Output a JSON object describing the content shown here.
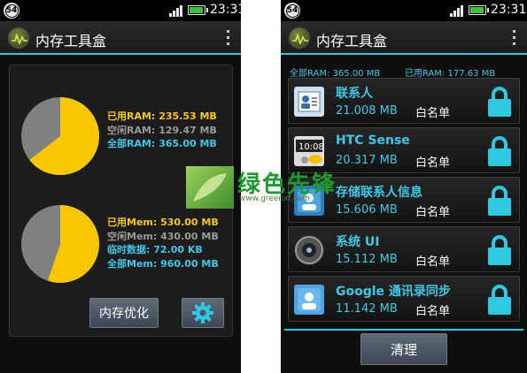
{
  "left_screen": {
    "status_bar": {
      "notification_count": "54",
      "time": "23:31"
    },
    "app_title": "内存工具盒",
    "ram_stats": {
      "used_label": "已用RAM:",
      "used_value": "235.53 MB",
      "free_label": "空闲RAM:",
      "free_value": "129.47 MB",
      "total_label": "全部RAM:",
      "total_value": "365.00 MB",
      "used_fraction": 0.645
    },
    "mem_stats": {
      "used_label": "已用Mem:",
      "used_value": "530.00 MB",
      "free_label": "空闲Mem:",
      "free_value": "430.00 MB",
      "temp_label": "临时数据:",
      "temp_value": "72.00 KB",
      "total_label": "全部Mem:",
      "total_value": "960.00 MB",
      "used_fraction": 0.552
    },
    "optimize_button": "内存优化"
  },
  "right_screen": {
    "status_bar": {
      "notification_count": "54",
      "time": "23:31"
    },
    "app_title": "内存工具盒",
    "summary": {
      "total": "全部RAM: 365.00 MB",
      "used": "已用RAM: 177.63 MB"
    },
    "apps": [
      {
        "name": "联系人",
        "size": "21.008 MB",
        "tag": "白名单",
        "icon": "contacts-icon"
      },
      {
        "name": "HTC Sense",
        "size": "20.317 MB",
        "tag": "白名单",
        "icon": "htc-sense-icon"
      },
      {
        "name": "存储联系人信息",
        "size": "15.606 MB",
        "tag": "白名单",
        "icon": "contacts-storage-icon"
      },
      {
        "name": "系统 UI",
        "size": "15.112 MB",
        "tag": "白名单",
        "icon": "system-ui-icon"
      },
      {
        "name": "Google 通讯录同步",
        "size": "11.142 MB",
        "tag": "白名单",
        "icon": "google-contacts-sync-icon"
      }
    ],
    "clean_button": "清理"
  },
  "watermark": {
    "text": "绿色先锋",
    "url": "www.greenxf.com"
  },
  "colors": {
    "accent": "#2ec8e0",
    "used": "#f7c800",
    "free": "#808080",
    "lock": "#2ec8e0"
  }
}
